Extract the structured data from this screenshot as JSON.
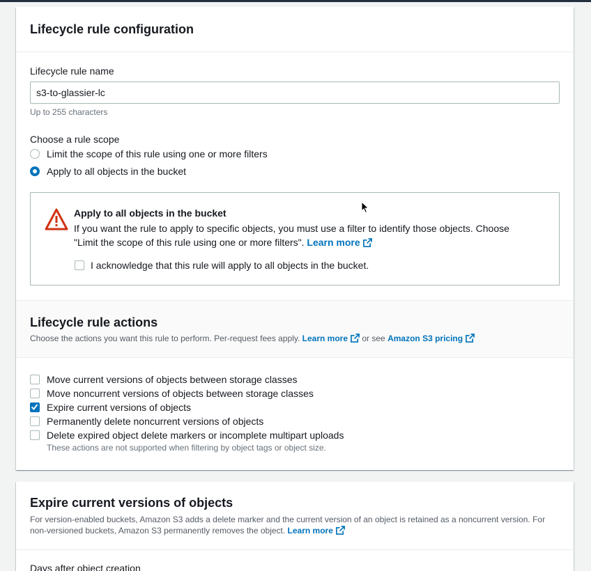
{
  "config": {
    "title": "Lifecycle rule configuration",
    "name_label": "Lifecycle rule name",
    "name_value": "s3-to-glassier-lc",
    "name_hint": "Up to 255 characters",
    "scope_label": "Choose a rule scope",
    "scope_options": [
      "Limit the scope of this rule using one or more filters",
      "Apply to all objects in the bucket"
    ],
    "alert": {
      "title": "Apply to all objects in the bucket",
      "text": "If you want the rule to apply to specific objects, you must use a filter to identify those objects. Choose",
      "text2": "\"Limit the scope of this rule using one or more filters\".",
      "learn_more": "Learn more",
      "ack": "I acknowledge that this rule will apply to all objects in the bucket."
    }
  },
  "actions": {
    "title": "Lifecycle rule actions",
    "desc": "Choose the actions you want this rule to perform. Per-request fees apply.",
    "learn_more": "Learn more",
    "or_see": "or see",
    "pricing": "Amazon S3 pricing",
    "options": [
      "Move current versions of objects between storage classes",
      "Move noncurrent versions of objects between storage classes",
      "Expire current versions of objects",
      "Permanently delete noncurrent versions of objects",
      "Delete expired object delete markers or incomplete multipart uploads"
    ],
    "note": "These actions are not supported when filtering by object tags or object size."
  },
  "expire": {
    "title": "Expire current versions of objects",
    "desc1": "For version-enabled buckets, Amazon S3 adds a delete marker and the current version of an object is retained as a noncurrent version. For",
    "desc2": "non-versioned buckets, Amazon S3 permanently removes the object.",
    "learn_more": "Learn more",
    "days_label": "Days after object creation"
  },
  "colors": {
    "link": "#0073bb",
    "warning": "#d13212",
    "header_bg": "#232f3e"
  }
}
